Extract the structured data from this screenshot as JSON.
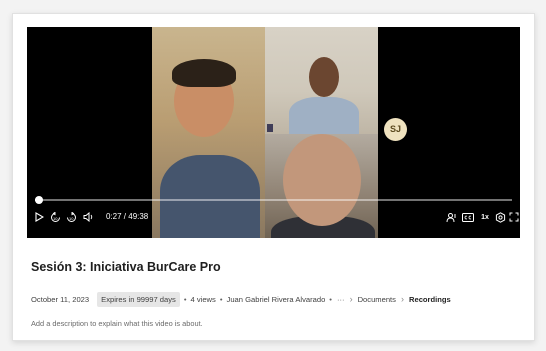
{
  "video": {
    "title": "Sesión 3: Iniciativa BurCare Pro",
    "current_time": "0:27",
    "duration": "49:38",
    "time_display": "0:27 / 49:38",
    "progress_fraction": 0.009,
    "speed": "1x"
  },
  "participants": {
    "avatar_initials": "SJ"
  },
  "meta": {
    "date": "October 11, 2023",
    "expires": "Expires in 99997 days",
    "views": "4 views",
    "owner": "Juan Gabriel Rivera Alvarado",
    "more": "···",
    "breadcrumb": [
      "Documents",
      "Recordings"
    ]
  },
  "description_placeholder": "Add a description to explain what this video is about.",
  "icons": {
    "play": "play-icon",
    "rewind": "rewind-10-icon",
    "forward": "forward-10-icon",
    "volume": "volume-icon",
    "captions_person": "speaker-icon",
    "captions": "captions-icon",
    "settings": "gear-icon",
    "fullscreen": "fullscreen-icon"
  },
  "colors": {
    "player_bg": "#000000",
    "accent": "#ffffff",
    "expires_bg": "#e6e6e6",
    "avatar_bg": "#efe2bf"
  }
}
